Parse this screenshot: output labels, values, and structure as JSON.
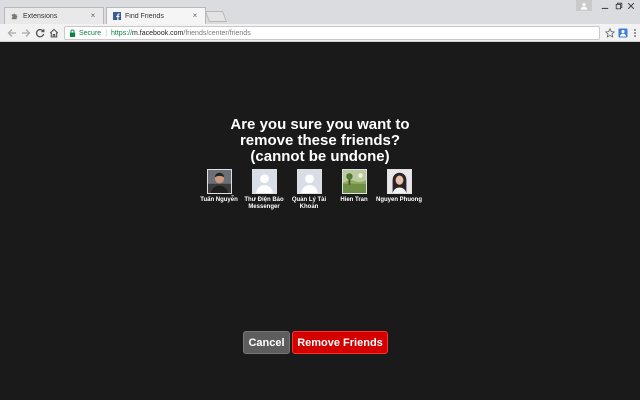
{
  "tabs": [
    {
      "title": "Extensions",
      "icon": "puzzle-icon",
      "active": false
    },
    {
      "title": "Find Friends",
      "icon": "facebook-icon",
      "active": true
    }
  ],
  "toolbar": {
    "secure_label": "Secure",
    "url_scheme": "https://",
    "url_host": "m.facebook.com",
    "url_path": "/friends/center/friends"
  },
  "dialog": {
    "question_lines": [
      "Are you sure you want to",
      "remove these friends?",
      "(cannot be undone)"
    ],
    "friends": [
      {
        "name": "Tuấn Nguyễn",
        "photo": "person-photo"
      },
      {
        "name": "Thư Điện Báo Messenger",
        "photo": "default-avatar"
      },
      {
        "name": "Quản Lý Tài Khoản",
        "photo": "default-avatar"
      },
      {
        "name": "Hien Tran",
        "photo": "landscape-photo"
      },
      {
        "name": "Nguyen Phuong",
        "photo": "person-photo"
      }
    ],
    "cancel_label": "Cancel",
    "remove_label": "Remove Friends"
  },
  "colors": {
    "page_bg": "#1a1a1a",
    "remove_button": "#d40000",
    "cancel_button": "#5d5d5d",
    "secure_green": "#0b8043"
  }
}
